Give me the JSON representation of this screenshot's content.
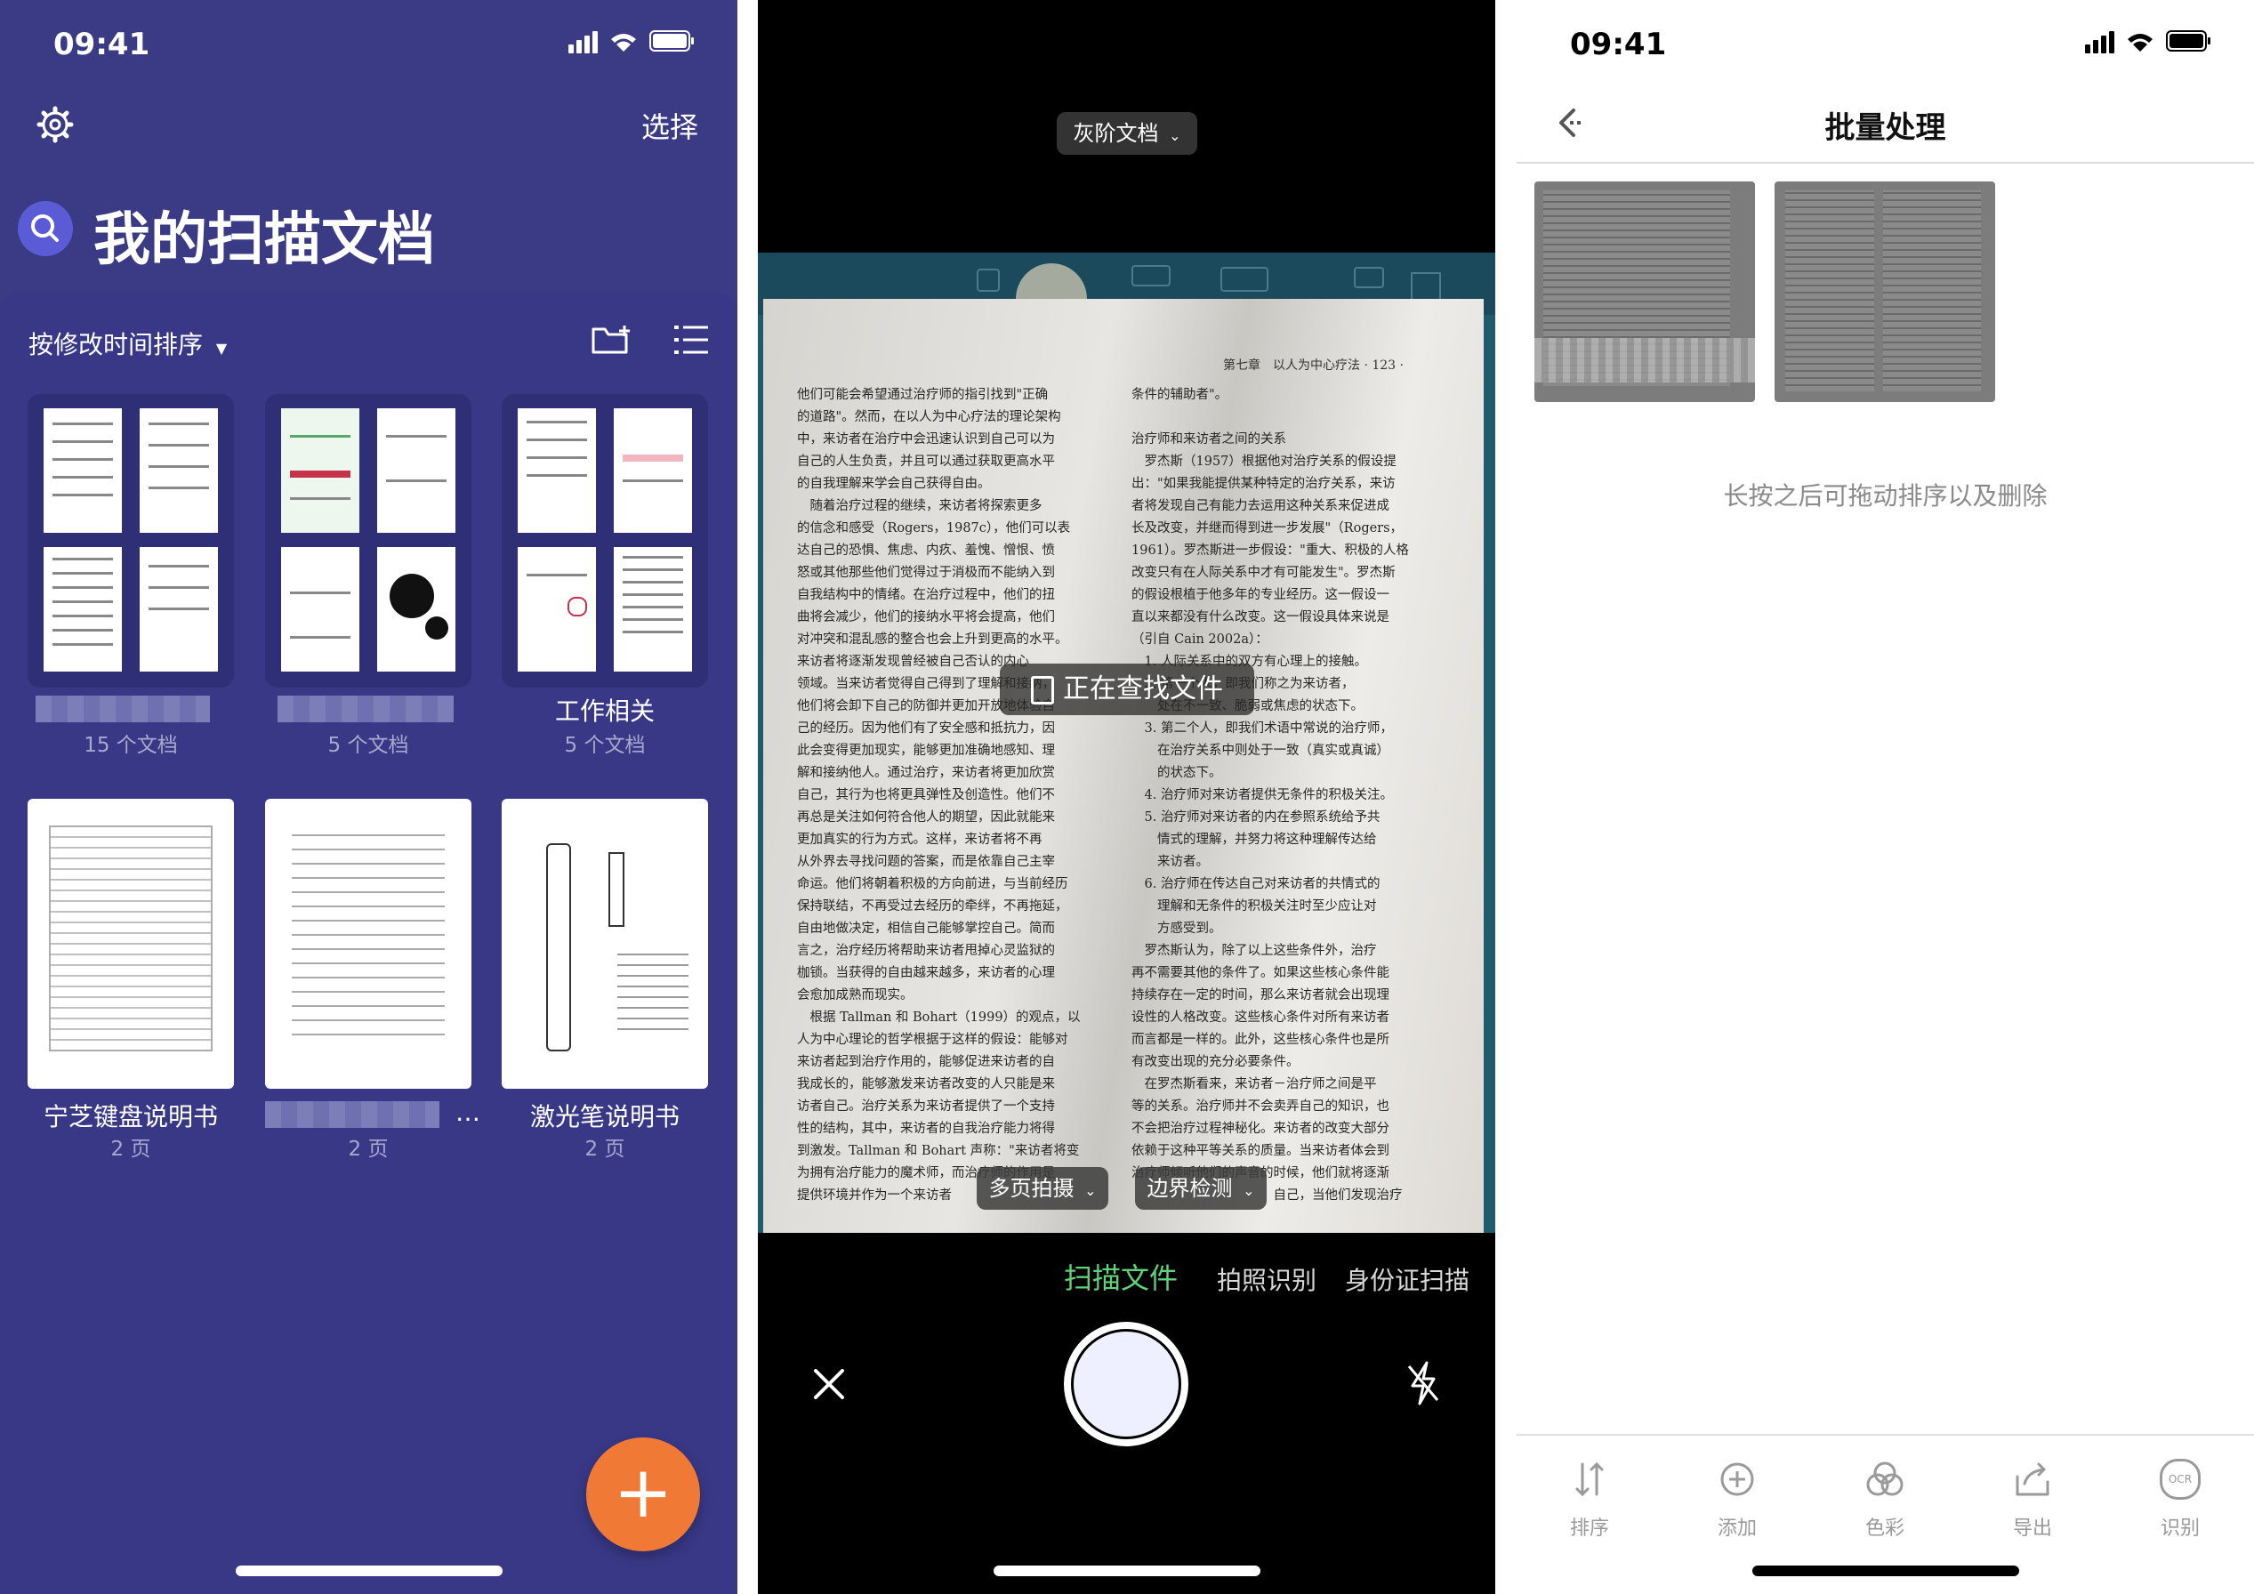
{
  "status": {
    "time": "09:41"
  },
  "home": {
    "select_label": "选择",
    "title": "我的扫描文档",
    "sort_label": "按修改时间排序",
    "folders": [
      {
        "name": "",
        "count": "15 个文档"
      },
      {
        "name": "",
        "count": "5 个文档"
      },
      {
        "name": "工作相关",
        "count": "5 个文档"
      }
    ],
    "docs": [
      {
        "name": "宁芝键盘说明书",
        "pages": "2 页"
      },
      {
        "name": "…",
        "pages": "2 页"
      },
      {
        "name": "激光笔说明书",
        "pages": "2 页"
      }
    ],
    "fab_label": "+",
    "colors": {
      "background": "#3a3a85",
      "fab": "#f07a35"
    }
  },
  "camera": {
    "mode_dropdown": "灰阶文档",
    "finding_text": "正在查找文件",
    "multi_page_dropdown": "多页拍摄",
    "edge_dropdown": "边界检测",
    "tabs": [
      "扫描文件",
      "拍照识别",
      "身份证扫描"
    ],
    "page": {
      "header": "第七章　以人为中心疗法 · 123 ·",
      "left_column": "他们可能会希望通过治疗师的指引找到\"正确\n的道路\"。然而，在以人为中心疗法的理论架构\n中，来访者在治疗中会迅速认识到自己可以为\n自己的人生负责，并且可以通过获取更高水平\n的自我理解来学会自己获得自由。\n　随着治疗过程的继续，来访者将探索更多\n的信念和感受（Rogers，1987c），他们可以表\n达自己的恐惧、焦虑、内疚、羞愧、憎恨、愤\n怒或其他那些他们觉得过于消极而不能纳入到\n自我结构中的情绪。在治疗过程中，他们的扭\n曲将会减少，他们的接纳水平将会提高，他们\n对冲突和混乱感的整合也会上升到更高的水平。\n来访者将逐渐发现曾经被自己否认的内心\n领域。当来访者觉得自己得到了理解和接纳，\n他们将会卸下自己的防御并更加开放地体验自\n己的经历。因为他们有了安全感和抵抗力，因\n此会变得更加现实，能够更加准确地感知、理\n解和接纳他人。通过治疗，来访者将更加欣赏\n自己，其行为也将更具弹性及创造性。他们不\n再总是关注如何符合他人的期望，因此就能来\n更加真实的行为方式。这样，来访者将不再\n从外界去寻找问题的答案，而是依靠自己主宰\n命运。他们将朝着积极的方向前进，与当前经历\n保持联结，不再受过去经历的牵绊，不再拖延，\n自由地做决定，相信自己能够掌控自己。简而\n言之，治疗经历将帮助来访者甩掉心灵监狱的\n枷锁。当获得的自由越来越多，来访者的心理\n会愈加成熟而现实。\n　根据 Tallman 和 Bohart（1999）的观点，以\n人为中心理论的哲学根据于这样的假设：能够对\n来访者起到治疗作用的，能够促进来访者的自\n我成长的，能够激发来访者改变的人只能是来\n访者自己。治疗关系为来访者提供了一个支持\n性的结构，其中，来访者的自我治疗能力将得\n到激发。Tallman 和 Bohart 声称：\"来访者将变\n为拥有治疗能力的魔术师，而治疗师的作用是\n提供环境并作为一个来访者",
      "right_column": "条件的辅助者\"。\n\n治疗师和来访者之间的关系\n　罗杰斯（1957）根据他对治疗关系的假设提\n出：\"如果我能提供某种特定的治疗关系，来访\n者将发现自己有能力去运用这种关系来促进成\n长及改变，并继而得到进一步发展\"（Rogers，\n1961）。罗杰斯进一步假设：\"重大、积极的人格\n改变只有在人际关系中才有可能发生\"。罗杰斯\n的假设根植于他多年的专业经历。这一假设一\n直以来都没有什么改变。这一假设具体来说是\n（引自 Cain 2002a）：\n　1. 人际关系中的双方有心理上的接触。\n　2. 第一个人，即我们称之为来访者，\n　　处在不一致、脆弱或焦虑的状态下。\n　3. 第二个人，即我们术语中常说的治疗师，\n　　在治疗关系中则处于一致（真实或真诚）\n　　的状态下。\n　4. 治疗师对来访者提供无条件的积极关注。\n　5. 治疗师对来访者的内在参照系统给予共\n　　情式的理解，并努力将这种理解传达给\n　　来访者。\n　6. 治疗师在传达自己对来访者的共情式的\n　　理解和无条件的积极关注时至少应让对\n　　方感受到。\n　罗杰斯认为，除了以上这些条件外，治疗\n再不需要其他的条件了。如果这些核心条件能\n持续存在一定的时间，那么来访者就会出现理\n设性的人格改变。这些核心条件对所有来访者\n而言都是一样的。此外，这些核心条件也是所\n有改变出现的充分必要条件。\n　在罗杰斯看来，来访者－治疗师之间是平\n等的关系。治疗师并不会卖弄自己的知识，也\n不会把治疗过程神秘化。来访者的改变大部分\n依赖于这种平等关系的质量。当来访者体会到\n治疗师倾听他们的声音的时候，他们就将逐渐\n　　　　　　　　　　　自己，当他们发现治疗"
    },
    "colors": {
      "active_tab": "#5fd37a"
    }
  },
  "batch": {
    "back_label": "<",
    "title": "批量处理",
    "hint": "长按之后可拖动排序以及删除",
    "tools": [
      {
        "icon": "sort-icon",
        "label": "排序"
      },
      {
        "icon": "add-icon",
        "label": "添加"
      },
      {
        "icon": "color-icon",
        "label": "色彩"
      },
      {
        "icon": "export-icon",
        "label": "导出"
      },
      {
        "icon": "ocr-icon",
        "label": "识别",
        "icon_text": "OCR"
      }
    ]
  }
}
